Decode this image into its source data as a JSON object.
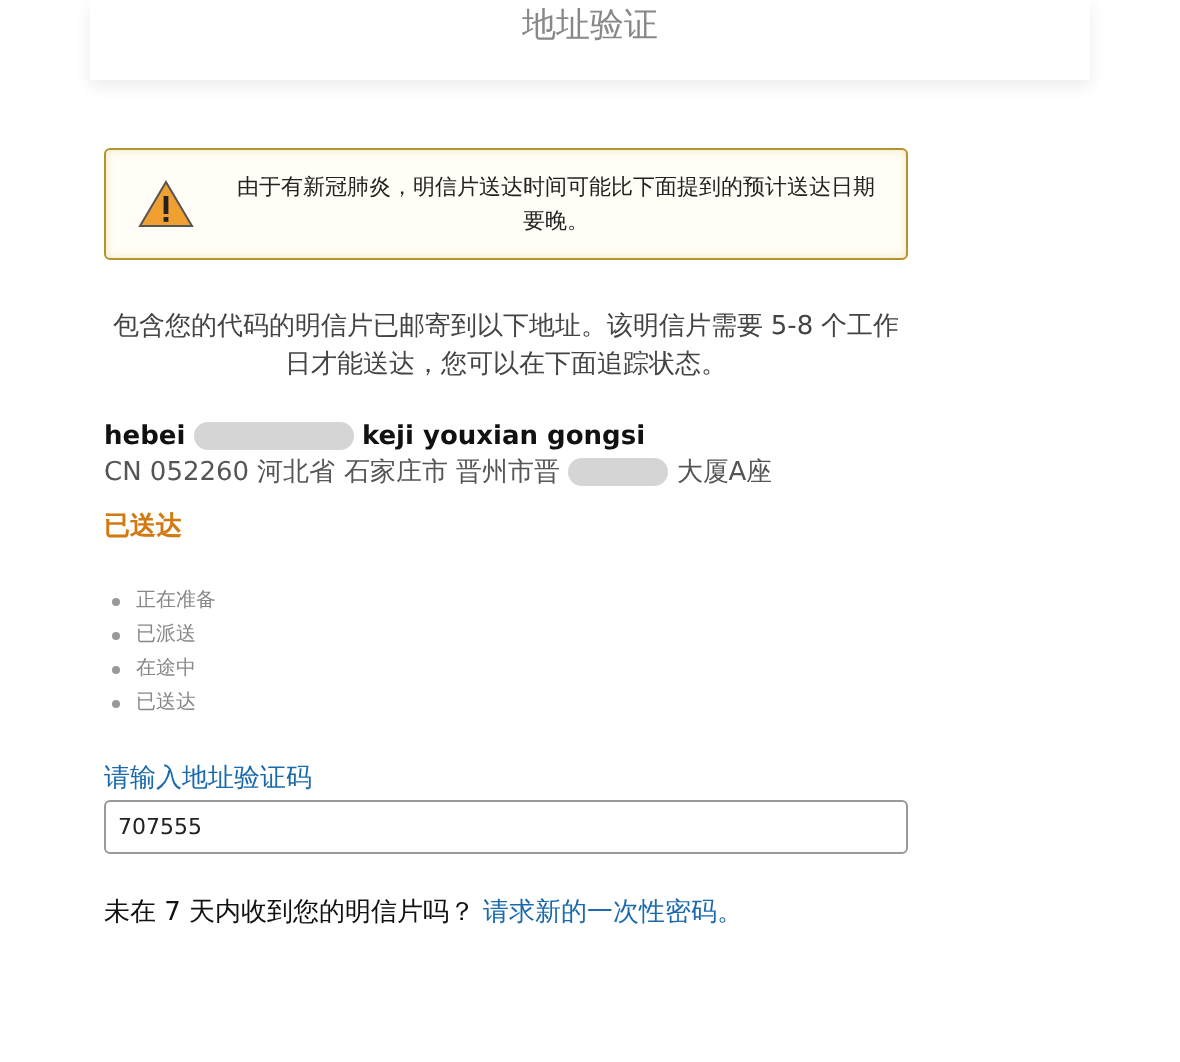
{
  "title": "地址验证",
  "alert": {
    "text": "由于有新冠肺炎，明信片送达时间可能比下面提到的预计送达日期要晚。"
  },
  "intro": "包含您的代码的明信片已邮寄到以下地址。该明信片需要 5-8 个工作日才能送达，您可以在下面追踪状态。",
  "address": {
    "name_start": "hebei",
    "name_end": "keji youxian gongsi",
    "line_start": "CN 052260 河北省 石家庄市 晋州市晋",
    "line_end": "大厦A座"
  },
  "status": "已送达",
  "steps": [
    "正在准备",
    "已派送",
    "在途中",
    "已送达"
  ],
  "code_field": {
    "label": "请输入地址验证码",
    "value": "707555"
  },
  "footer": {
    "text": "未在 7 天内收到您的明信片吗？",
    "link": "请求新的一次性密码。"
  }
}
